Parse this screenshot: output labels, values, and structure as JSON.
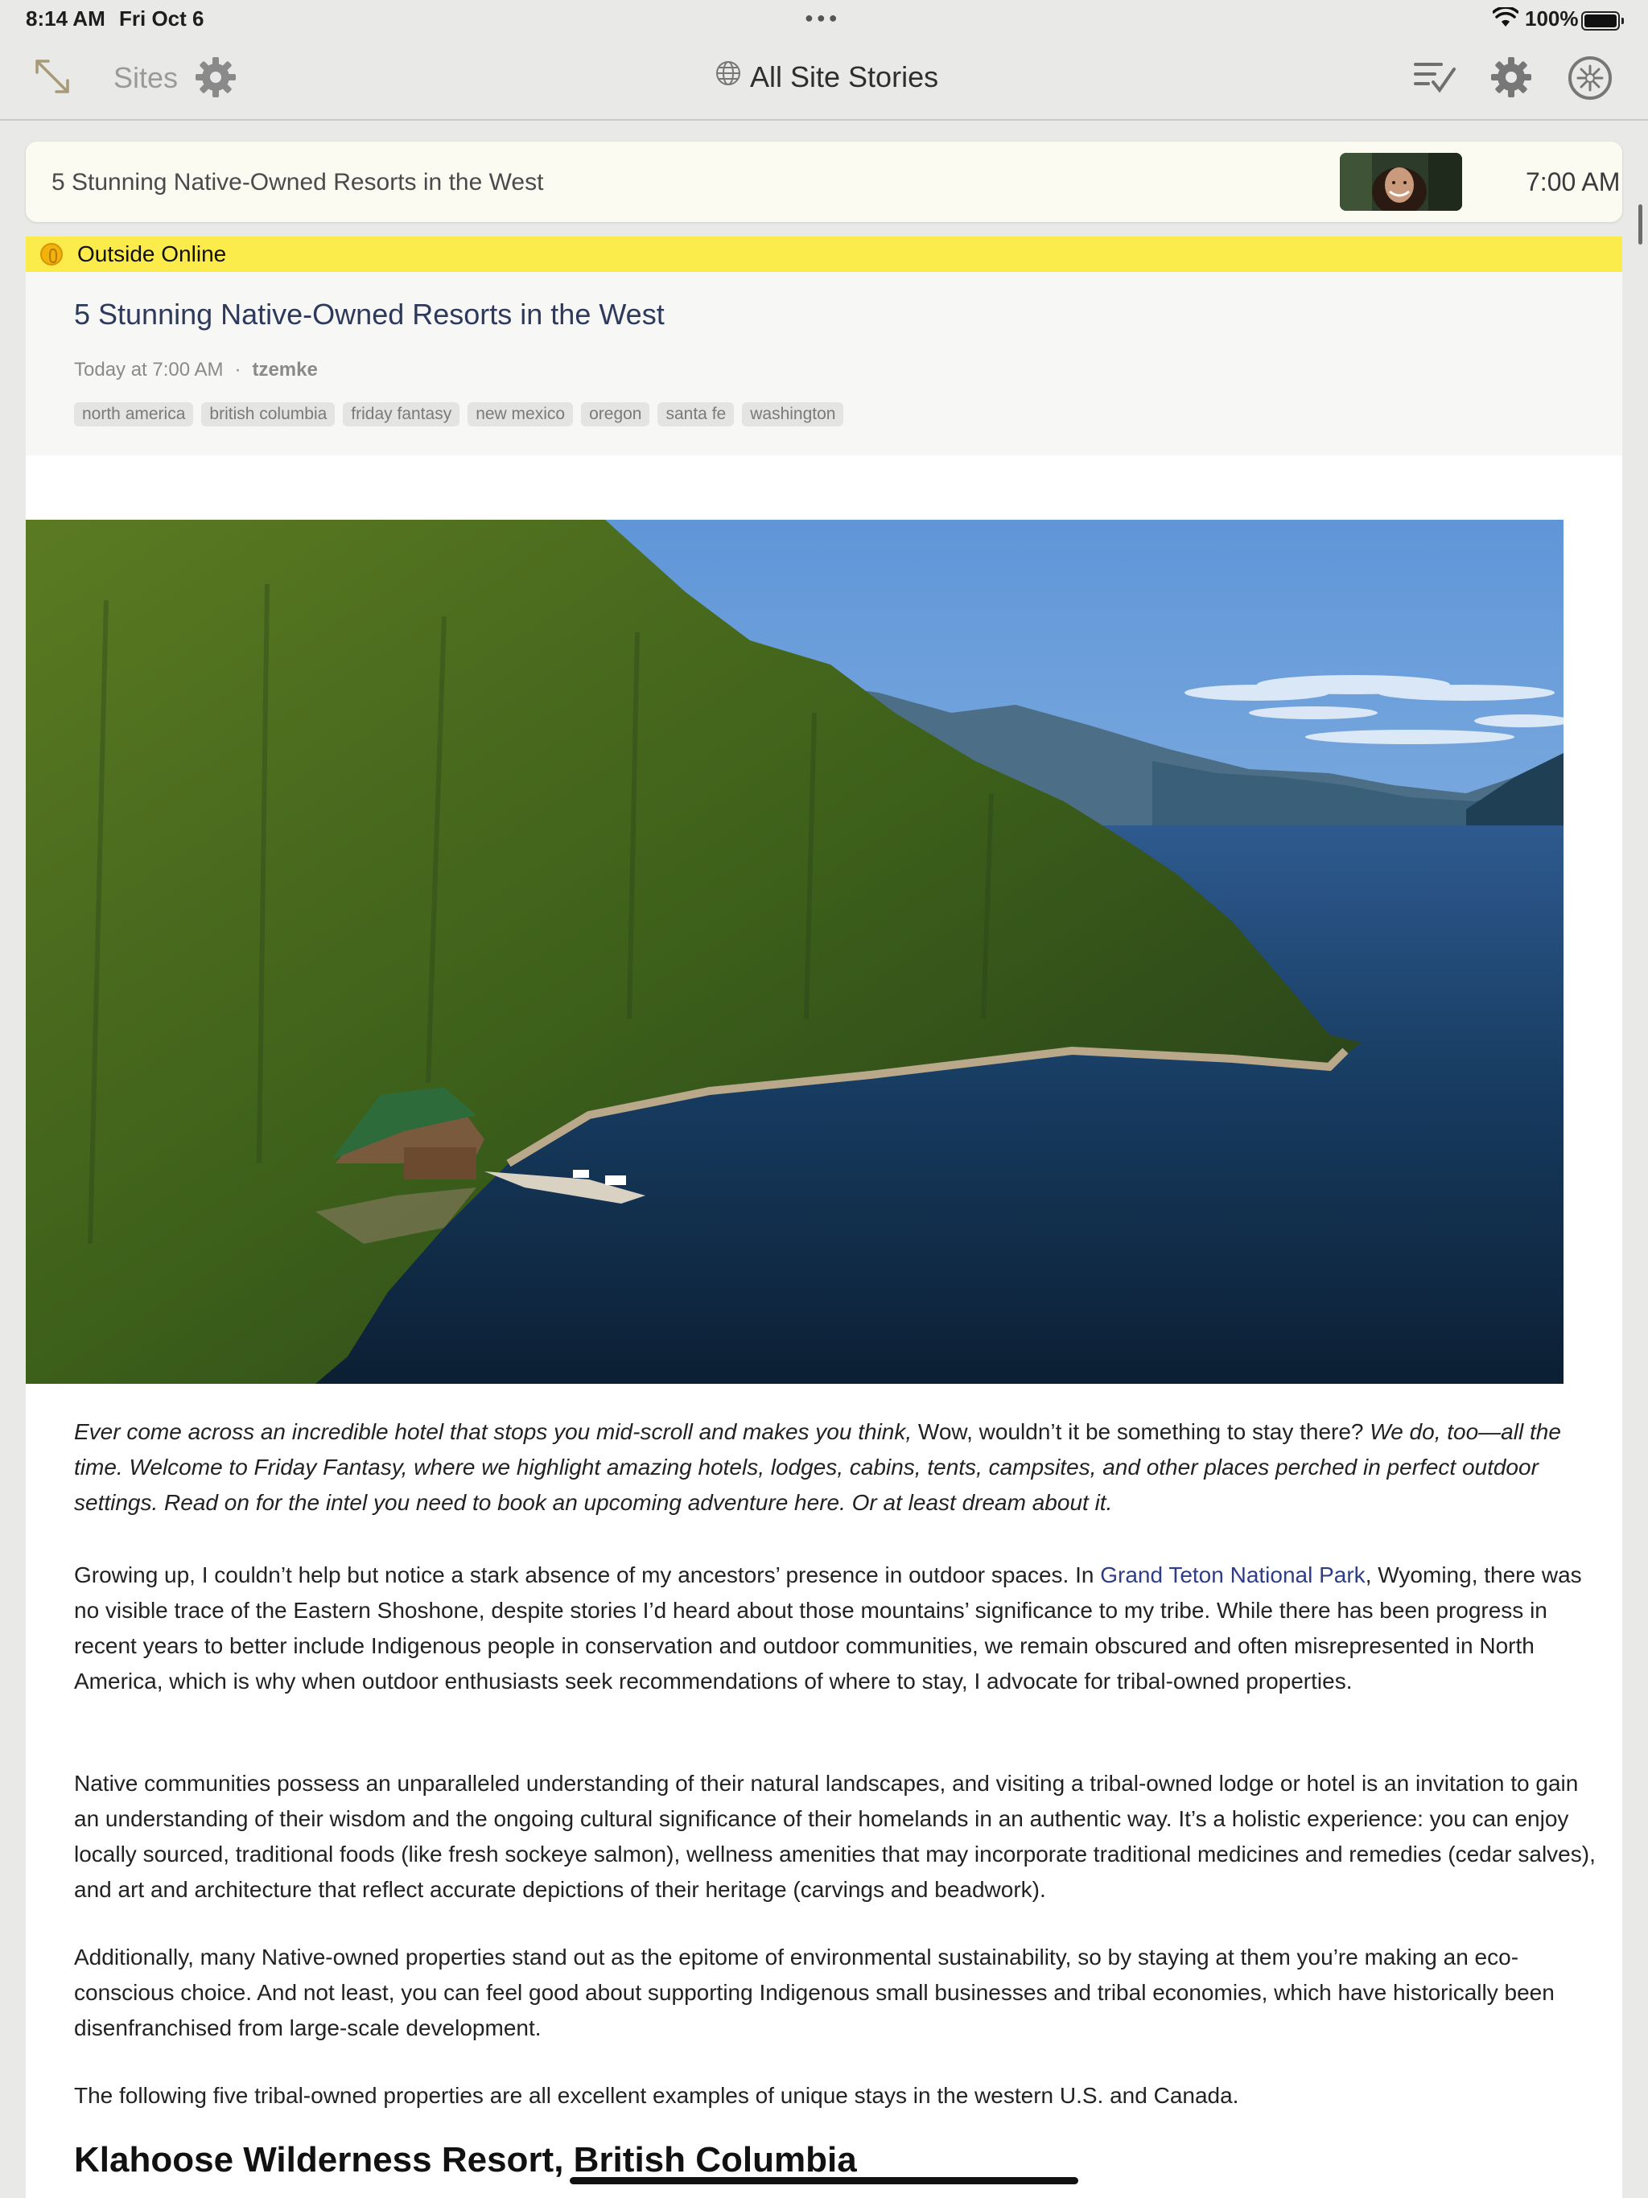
{
  "status_bar": {
    "time": "8:14 AM",
    "date": "Fri Oct 6",
    "battery": "100%"
  },
  "toolbar": {
    "sites_label": "Sites",
    "title": "All Site Stories",
    "icons": [
      "expand-icon",
      "gear-icon",
      "globe-icon",
      "mark-read-icon",
      "gear-icon",
      "compass-icon"
    ]
  },
  "story_row": {
    "title": "5 Stunning Native-Owned Resorts in the West",
    "time": "7:00 AM"
  },
  "feed": {
    "name": "Outside Online",
    "bar_color": "#fbec4c"
  },
  "article": {
    "title": "5 Stunning Native-Owned Resorts in the West",
    "date": "Today at 7:00 AM",
    "separator": "·",
    "author": "tzemke",
    "tags": [
      "north america",
      "british columbia",
      "friday fantasy",
      "new mexico",
      "oregon",
      "santa fe",
      "washington"
    ],
    "intro": {
      "a": "Ever come across an incredible hotel that stops you mid-scroll and makes you think,",
      "b": " Wow, wouldn’t it be something to stay there?",
      "c": " We do, too—all the time. Welcome to Friday Fantasy, where we highlight amazing hotels, lodges, cabins, tents, campsites, and other places perched in perfect outdoor settings. Read on for the intel you need to book an upcoming adventure here. Or at least dream about it."
    },
    "p2": {
      "a": "Growing up, I couldn’t help but notice a stark absence of my ancestors’ presence in outdoor spaces. In ",
      "link": "Grand Teton National Park",
      "b": ", Wyoming, there was no visible trace of the Eastern Shoshone, despite stories I’d heard about those mountains’ significance to my tribe. While there has been progress in recent years to better include Indigenous people in conservation and outdoor communities, we remain obscured and often misrepresented in North America, which is why when outdoor enthusiasts seek recommendations of where to stay, I advocate for tribal-owned properties."
    },
    "p3": "Native communities possess an unparalleled understanding of their natural landscapes, and visiting a tribal-owned lodge or hotel is an invitation to gain an understanding of their wisdom and the ongoing cultural significance of their homelands in an authentic way. It’s a holistic experience: you can enjoy locally sourced, traditional foods (like fresh sockeye salmon), wellness amenities that may incorporate traditional medicines and remedies (cedar salves), and art and architecture that reflect accurate depictions of their heritage (carvings and beadwork).",
    "p4": "Additionally, many Native-owned properties stand out as the epitome of environmental sustainability, so by staying at them you’re making an eco-conscious choice. And not least, you can feel good about supporting Indigenous small businesses and tribal economies, which have historically been disenfranchised from large-scale development.",
    "p5": "The following five tribal-owned properties are all excellent examples of unique stays in the western U.S. and Canada.",
    "subheading": "Klahoose Wilderness Resort, British Columbia"
  }
}
